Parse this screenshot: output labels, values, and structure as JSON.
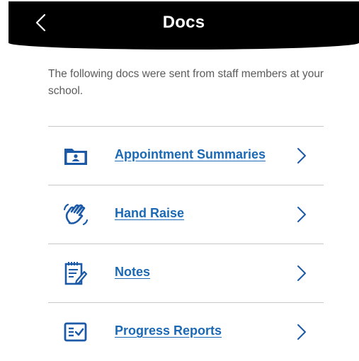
{
  "header": {
    "title": "Docs",
    "back_icon": "chevron-left-icon"
  },
  "intro_text": "The following docs were sent from staff members at your school.",
  "colors": {
    "header_bg": "#000000",
    "link": "#1b69b5",
    "icon": "#1c5aa8",
    "divider": "#c8c8c8"
  },
  "docs": [
    {
      "label": "Appointment Summaries",
      "icon": "folder-person-icon"
    },
    {
      "label": "Hand Raise",
      "icon": "hand-wave-icon"
    },
    {
      "label": "Notes",
      "icon": "notepad-pencil-icon"
    },
    {
      "label": "Progress Reports",
      "icon": "checklist-icon"
    }
  ]
}
